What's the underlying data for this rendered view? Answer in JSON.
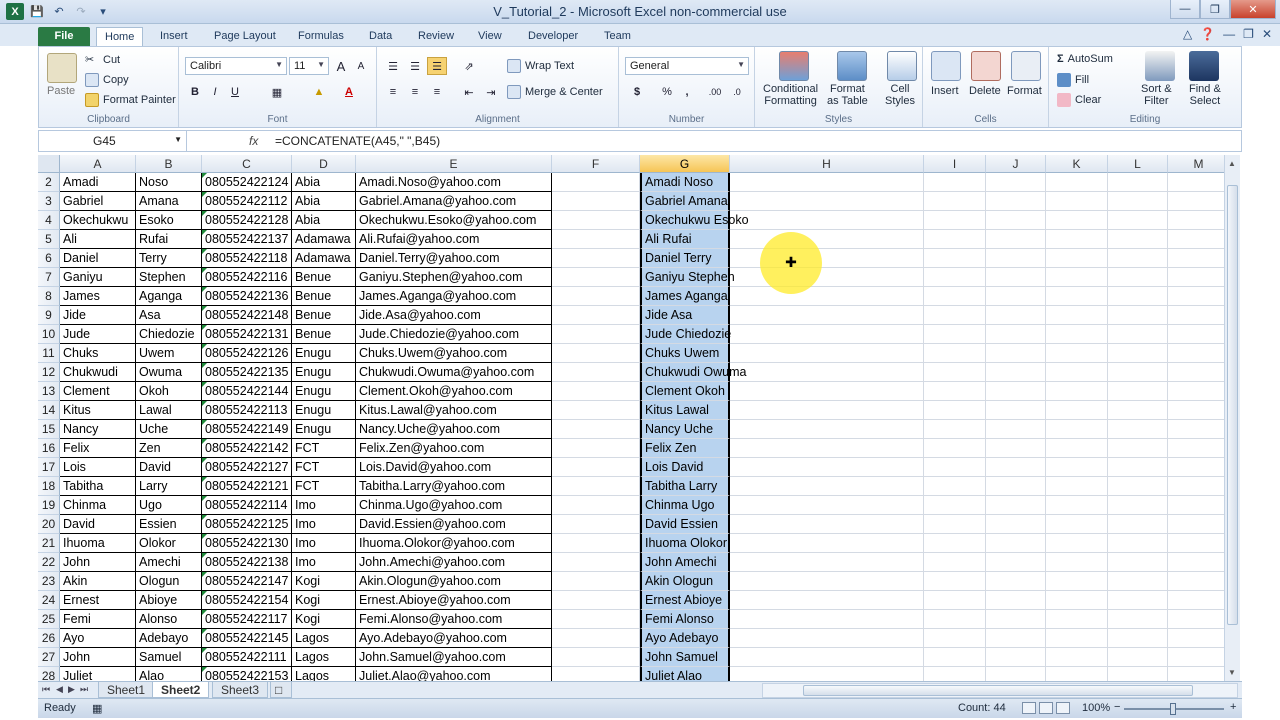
{
  "window": {
    "title": "V_Tutorial_2  -  Microsoft Excel non-commercial use",
    "logo": "X"
  },
  "tabs": [
    "File",
    "Home",
    "Insert",
    "Page Layout",
    "Formulas",
    "Data",
    "Review",
    "View",
    "Developer",
    "Team"
  ],
  "ribbon": {
    "clipboard": {
      "paste": "Paste",
      "cut": "Cut",
      "copy": "Copy",
      "format_painter": "Format Painter",
      "label": "Clipboard"
    },
    "font": {
      "name": "Calibri",
      "size": "11",
      "bold": "B",
      "italic": "I",
      "underline": "U",
      "grow": "A",
      "shrink": "A",
      "color": "A",
      "label": "Font"
    },
    "alignment": {
      "wrap": "Wrap Text",
      "merge": "Merge & Center",
      "label": "Alignment"
    },
    "number": {
      "format": "General",
      "currency": "$",
      "percent": "%",
      "comma": ",",
      "inc": ".00",
      "dec": ".0",
      "label": "Number"
    },
    "styles": {
      "cond1": "Conditional",
      "cond2": "Formatting",
      "fmt1": "Format",
      "fmt2": "as Table",
      "cell1": "Cell",
      "cell2": "Styles",
      "label": "Styles"
    },
    "cells": {
      "insert": "Insert",
      "delete": "Delete",
      "format": "Format",
      "label": "Cells"
    },
    "editing": {
      "autosum": "AutoSum",
      "fill": "Fill",
      "clear": "Clear",
      "sort1": "Sort &",
      "sort2": "Filter",
      "find1": "Find &",
      "find2": "Select",
      "label": "Editing"
    }
  },
  "formula_bar": {
    "name_box": "G45",
    "fx": "fx",
    "formula": "=CONCATENATE(A45,\" \",B45)"
  },
  "columns": [
    "A",
    "B",
    "C",
    "D",
    "E",
    "F",
    "G",
    "H",
    "I",
    "J",
    "K",
    "L",
    "M"
  ],
  "selected_column": "G",
  "rows": [
    {
      "n": "2",
      "a": "Amadi",
      "b": "Noso",
      "c": "080552422124",
      "d": "Abia",
      "e": "Amadi.Noso@yahoo.com",
      "g": "Amadi Noso"
    },
    {
      "n": "3",
      "a": "Gabriel",
      "b": "Amana",
      "c": "080552422112",
      "d": "Abia",
      "e": "Gabriel.Amana@yahoo.com",
      "g": "Gabriel Amana"
    },
    {
      "n": "4",
      "a": "Okechukwu",
      "b": "Esoko",
      "c": "080552422128",
      "d": "Abia",
      "e": "Okechukwu.Esoko@yahoo.com",
      "g": "Okechukwu Esoko"
    },
    {
      "n": "5",
      "a": "Ali",
      "b": "Rufai",
      "c": "080552422137",
      "d": "Adamawa",
      "e": "Ali.Rufai@yahoo.com",
      "g": "Ali Rufai"
    },
    {
      "n": "6",
      "a": "Daniel",
      "b": "Terry",
      "c": "080552422118",
      "d": "Adamawa",
      "e": "Daniel.Terry@yahoo.com",
      "g": "Daniel Terry"
    },
    {
      "n": "7",
      "a": "Ganiyu",
      "b": "Stephen",
      "c": "080552422116",
      "d": "Benue",
      "e": "Ganiyu.Stephen@yahoo.com",
      "g": "Ganiyu Stephen"
    },
    {
      "n": "8",
      "a": "James",
      "b": "Aganga",
      "c": "080552422136",
      "d": "Benue",
      "e": "James.Aganga@yahoo.com",
      "g": "James Aganga"
    },
    {
      "n": "9",
      "a": "Jide",
      "b": "Asa",
      "c": "080552422148",
      "d": "Benue",
      "e": "Jide.Asa@yahoo.com",
      "g": "Jide Asa"
    },
    {
      "n": "10",
      "a": "Jude",
      "b": "Chiedozie",
      "c": "080552422131",
      "d": "Benue",
      "e": "Jude.Chiedozie@yahoo.com",
      "g": "Jude Chiedozie"
    },
    {
      "n": "11",
      "a": "Chuks",
      "b": "Uwem",
      "c": "080552422126",
      "d": "Enugu",
      "e": "Chuks.Uwem@yahoo.com",
      "g": "Chuks Uwem"
    },
    {
      "n": "12",
      "a": "Chukwudi",
      "b": "Owuma",
      "c": "080552422135",
      "d": "Enugu",
      "e": "Chukwudi.Owuma@yahoo.com",
      "g": "Chukwudi Owuma"
    },
    {
      "n": "13",
      "a": "Clement",
      "b": "Okoh",
      "c": "080552422144",
      "d": "Enugu",
      "e": "Clement.Okoh@yahoo.com",
      "g": "Clement Okoh"
    },
    {
      "n": "14",
      "a": "Kitus",
      "b": "Lawal",
      "c": "080552422113",
      "d": "Enugu",
      "e": "Kitus.Lawal@yahoo.com",
      "g": "Kitus Lawal"
    },
    {
      "n": "15",
      "a": "Nancy",
      "b": "Uche",
      "c": "080552422149",
      "d": "Enugu",
      "e": "Nancy.Uche@yahoo.com",
      "g": "Nancy Uche"
    },
    {
      "n": "16",
      "a": "Felix",
      "b": "Zen",
      "c": "080552422142",
      "d": "FCT",
      "e": "Felix.Zen@yahoo.com",
      "g": "Felix Zen"
    },
    {
      "n": "17",
      "a": "Lois",
      "b": "David",
      "c": "080552422127",
      "d": "FCT",
      "e": "Lois.David@yahoo.com",
      "g": "Lois David"
    },
    {
      "n": "18",
      "a": "Tabitha",
      "b": "Larry",
      "c": "080552422121",
      "d": "FCT",
      "e": "Tabitha.Larry@yahoo.com",
      "g": "Tabitha Larry"
    },
    {
      "n": "19",
      "a": "Chinma",
      "b": "Ugo",
      "c": "080552422114",
      "d": "Imo",
      "e": "Chinma.Ugo@yahoo.com",
      "g": "Chinma Ugo"
    },
    {
      "n": "20",
      "a": "David",
      "b": "Essien",
      "c": "080552422125",
      "d": "Imo",
      "e": "David.Essien@yahoo.com",
      "g": "David Essien"
    },
    {
      "n": "21",
      "a": "Ihuoma",
      "b": "Olokor",
      "c": "080552422130",
      "d": "Imo",
      "e": "Ihuoma.Olokor@yahoo.com",
      "g": "Ihuoma Olokor"
    },
    {
      "n": "22",
      "a": "John",
      "b": "Amechi",
      "c": "080552422138",
      "d": "Imo",
      "e": "John.Amechi@yahoo.com",
      "g": "John Amechi"
    },
    {
      "n": "23",
      "a": "Akin",
      "b": "Ologun",
      "c": "080552422147",
      "d": "Kogi",
      "e": "Akin.Ologun@yahoo.com",
      "g": "Akin Ologun"
    },
    {
      "n": "24",
      "a": "Ernest",
      "b": "Abioye",
      "c": "080552422154",
      "d": "Kogi",
      "e": "Ernest.Abioye@yahoo.com",
      "g": "Ernest Abioye"
    },
    {
      "n": "25",
      "a": "Femi",
      "b": "Alonso",
      "c": "080552422117",
      "d": "Kogi",
      "e": "Femi.Alonso@yahoo.com",
      "g": "Femi Alonso"
    },
    {
      "n": "26",
      "a": "Ayo",
      "b": "Adebayo",
      "c": "080552422145",
      "d": "Lagos",
      "e": "Ayo.Adebayo@yahoo.com",
      "g": "Ayo Adebayo"
    },
    {
      "n": "27",
      "a": "John",
      "b": "Samuel",
      "c": "080552422111",
      "d": "Lagos",
      "e": "John.Samuel@yahoo.com",
      "g": "John Samuel"
    },
    {
      "n": "28",
      "a": "Juliet",
      "b": "Alao",
      "c": "080552422153",
      "d": "Lagos",
      "e": "Juliet.Alao@yahoo.com",
      "g": "Juliet Alao"
    }
  ],
  "sheets": [
    "Sheet1",
    "Sheet2",
    "Sheet3"
  ],
  "active_sheet": "Sheet2",
  "status": {
    "ready": "Ready",
    "count": "Count: 44",
    "zoom": "100%",
    "zoom_minus": "−",
    "zoom_plus": "+"
  },
  "colors": {
    "file_tab": "#2a7a44",
    "selection": "#b8d3ef",
    "column_header_selected": "#f6c556",
    "cursor_halo": "#ffeb28"
  }
}
